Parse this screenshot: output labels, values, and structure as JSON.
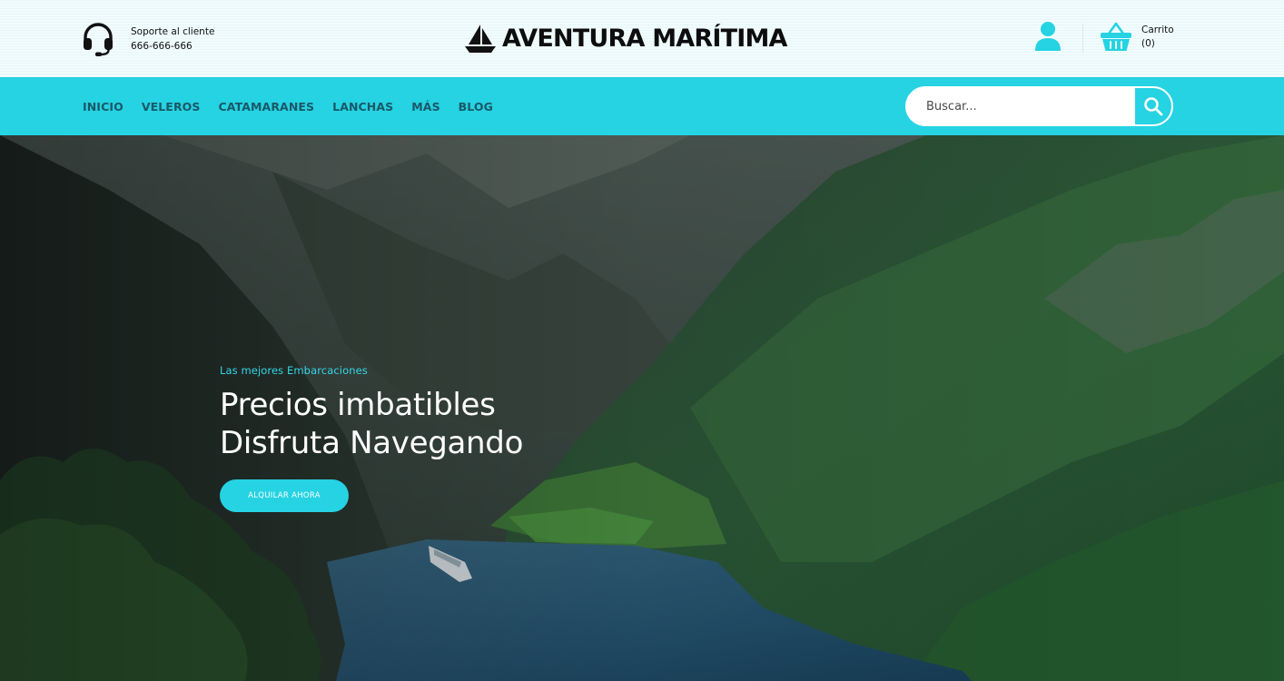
{
  "support": {
    "label": "Soporte al cliente",
    "phone": "666-666-666",
    "icon": "headset-icon"
  },
  "brand": {
    "name": "AVENTURA MARÍTIMA",
    "icon": "sailboat-icon"
  },
  "account": {
    "icon": "user-icon"
  },
  "cart": {
    "label": "Carrito",
    "count": "(0)",
    "icon": "basket-icon"
  },
  "nav": {
    "items": [
      "INICIO",
      "VELEROS",
      "CATAMARANES",
      "LANCHAS",
      "MÁS",
      "BLOG"
    ]
  },
  "search": {
    "placeholder": "Buscar...",
    "icon": "search-icon"
  },
  "hero": {
    "eyebrow": "Las mejores Embarcaciones",
    "title_line1": "Precios imbatibles",
    "title_line2": "Disfruta Navegando",
    "cta": "ALQUILAR AHORA"
  },
  "colors": {
    "accent": "#25d3e3",
    "nav_text": "#1a5866",
    "header_bg": "#f2fcfd"
  }
}
